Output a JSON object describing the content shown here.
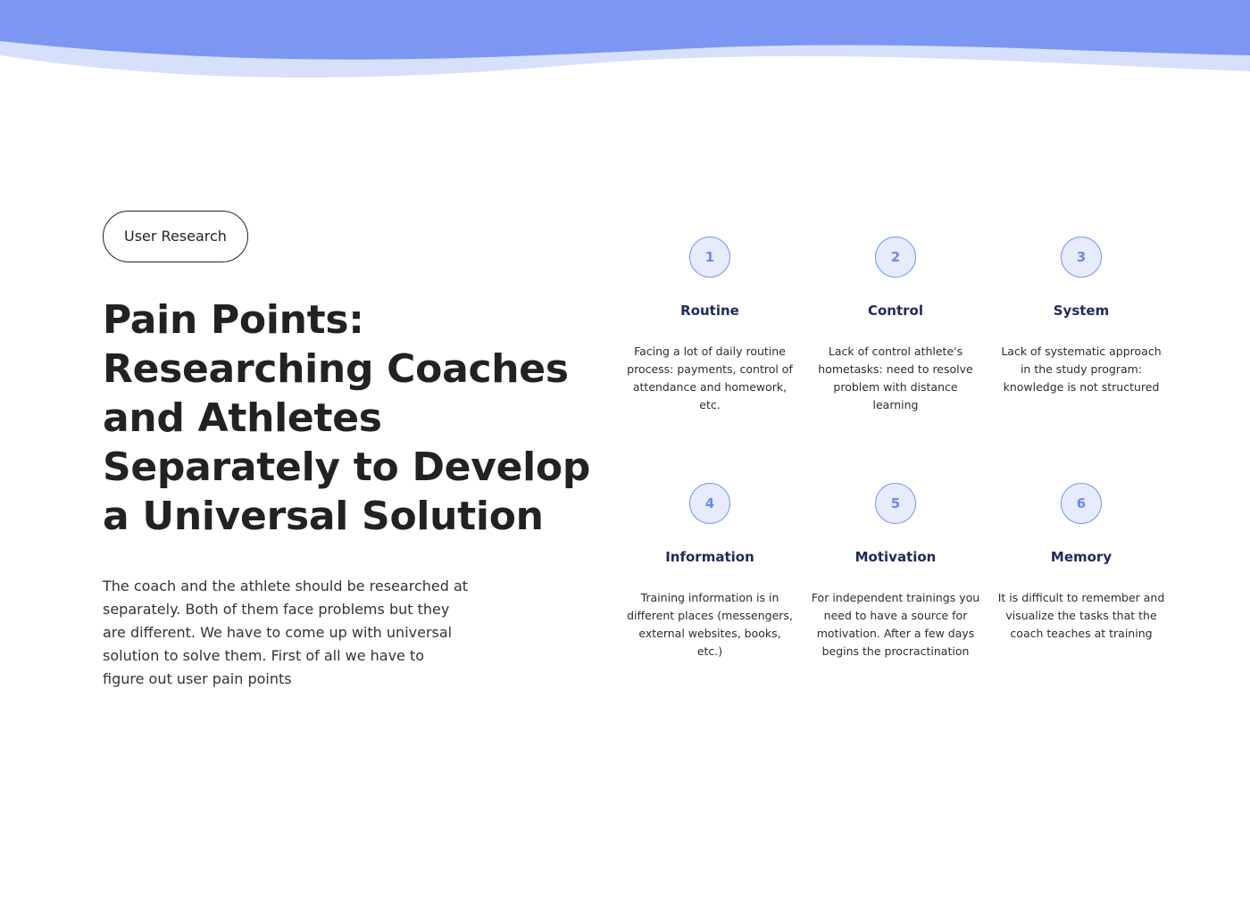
{
  "header": {
    "tag_label": "User Research",
    "title": "Pain Points: Researching Coaches and Athletes Separately to Develop a Universal Solution",
    "intro": "The coach and the athlete should be researched at separately. Both of them face problems but they are different. We have to come up with universal solution to solve them. First of all we have to figure out user pain points"
  },
  "colors": {
    "wave_primary": "#7b97f1",
    "wave_secondary": "#d7e0fb",
    "badge_fill": "#e6ecfc",
    "badge_border": "#7a97ef",
    "badge_text": "#7089e6",
    "card_title": "#1f2a5c",
    "text_dark": "#222222"
  },
  "pain_points": [
    {
      "number": "1",
      "title": "Routine",
      "description": "Facing a lot of daily routine process: payments, control of attendance and homework, etc."
    },
    {
      "number": "2",
      "title": "Control",
      "description": "Lack of control athlete's hometasks: need to resolve problem with distance learning"
    },
    {
      "number": "3",
      "title": "System",
      "description": "Lack of systematic approach in the study program: knowledge is not structured"
    },
    {
      "number": "4",
      "title": "Information",
      "description": "Training information is in different places (messengers, external websites, books, etc.)"
    },
    {
      "number": "5",
      "title": "Motivation",
      "description": "For independent trainings you need to have a source for motivation. After a few days begins the procractination"
    },
    {
      "number": "6",
      "title": "Memory",
      "description": "It is difficult to remember and visualize the tasks that the coach teaches at training"
    }
  ]
}
